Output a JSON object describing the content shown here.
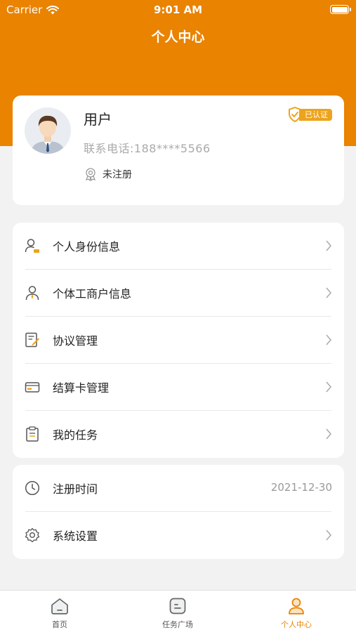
{
  "status_bar": {
    "carrier": "Carrier",
    "time": "9:01 AM",
    "icons": [
      "wifi-icon",
      "battery-icon"
    ]
  },
  "header": {
    "title": "个人中心",
    "accent_color": "#e98300"
  },
  "profile": {
    "name": "用户",
    "phone": "联系电话:188****5566",
    "verified_label": "已认证",
    "registration_status": "未注册"
  },
  "menu": {
    "items": [
      {
        "label": "个人身份信息",
        "icon": "person-id-icon"
      },
      {
        "label": "个体工商户信息",
        "icon": "business-person-icon"
      },
      {
        "label": "协议管理",
        "icon": "agreement-icon"
      },
      {
        "label": "结算卡管理",
        "icon": "card-icon"
      },
      {
        "label": "我的任务",
        "icon": "clipboard-icon"
      }
    ]
  },
  "settings": {
    "register_time_label": "注册时间",
    "register_time_value": "2021-12-30",
    "system_settings_label": "系统设置"
  },
  "tabbar": {
    "tabs": [
      {
        "label": "首页",
        "icon": "home-icon"
      },
      {
        "label": "任务广场",
        "icon": "task-square-icon"
      },
      {
        "label": "个人中心",
        "icon": "person-icon",
        "active": true
      }
    ],
    "active_color": "#e98300",
    "inactive_color": "#555555"
  }
}
